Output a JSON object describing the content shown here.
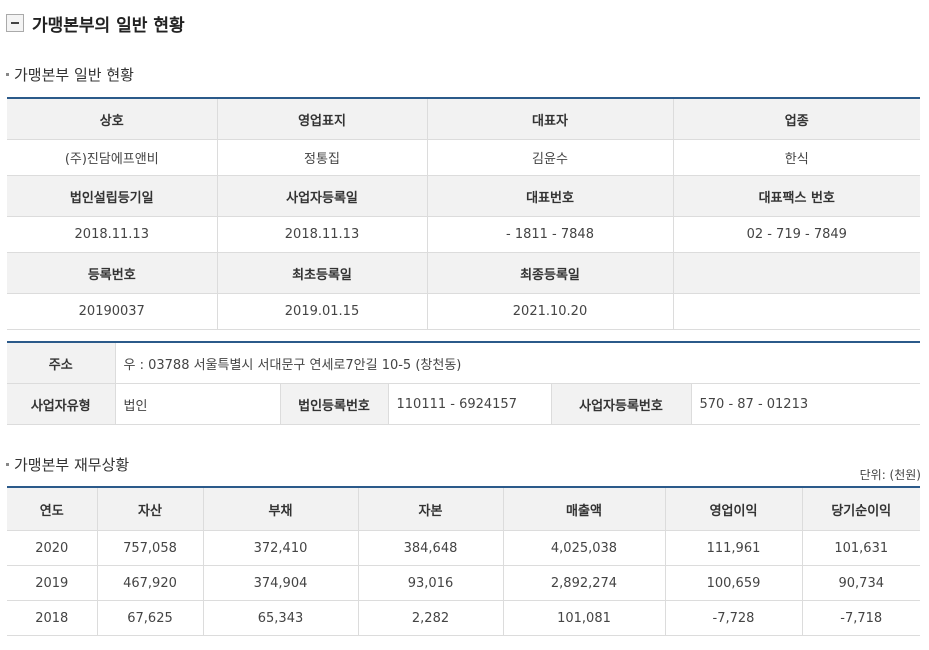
{
  "page": {
    "title": "가맹본부의 일반 현황"
  },
  "general": {
    "section_title": "가맹본부 일반 현황",
    "rows": [
      {
        "type": "header",
        "cells": [
          "상호",
          "영업표지",
          "대표자",
          "업종"
        ]
      },
      {
        "type": "data",
        "cells": [
          "(주)진담에프앤비",
          "정통집",
          "김윤수",
          "한식"
        ]
      },
      {
        "type": "header",
        "cells": [
          "법인설립등기일",
          "사업자등록일",
          "대표번호",
          "대표팩스 번호"
        ]
      },
      {
        "type": "data",
        "cells": [
          "2018.11.13",
          "2018.11.13",
          "- 1811 - 7848",
          "02 - 719 - 7849"
        ]
      },
      {
        "type": "header",
        "cells": [
          "등록번호",
          "최초등록일",
          "최종등록일",
          ""
        ]
      },
      {
        "type": "data",
        "cells": [
          "20190037",
          "2019.01.15",
          "2021.10.20",
          ""
        ]
      }
    ]
  },
  "address": {
    "label": "주소",
    "value": "우 : 03788 서울특별시 서대문구 연세로7안길 10-5 (창천동)",
    "biz_type_label": "사업자유형",
    "biz_type_value": "법인",
    "corp_reg_label": "법인등록번호",
    "corp_reg_value": "110111 - 6924157",
    "biz_reg_label": "사업자등록번호",
    "biz_reg_value": "570 - 87 - 01213"
  },
  "finance": {
    "section_title": "가맹본부 재무상황",
    "unit": "단위: (천원)",
    "headers": [
      "연도",
      "자산",
      "부채",
      "자본",
      "매출액",
      "영업이익",
      "당기순이익"
    ],
    "rows": [
      [
        "2020",
        "757,058",
        "372,410",
        "384,648",
        "4,025,038",
        "111,961",
        "101,631"
      ],
      [
        "2019",
        "467,920",
        "374,904",
        "93,016",
        "2,892,274",
        "100,659",
        "90,734"
      ],
      [
        "2018",
        "67,625",
        "65,343",
        "2,282",
        "101,081",
        "-7,728",
        "-7,718"
      ]
    ]
  }
}
